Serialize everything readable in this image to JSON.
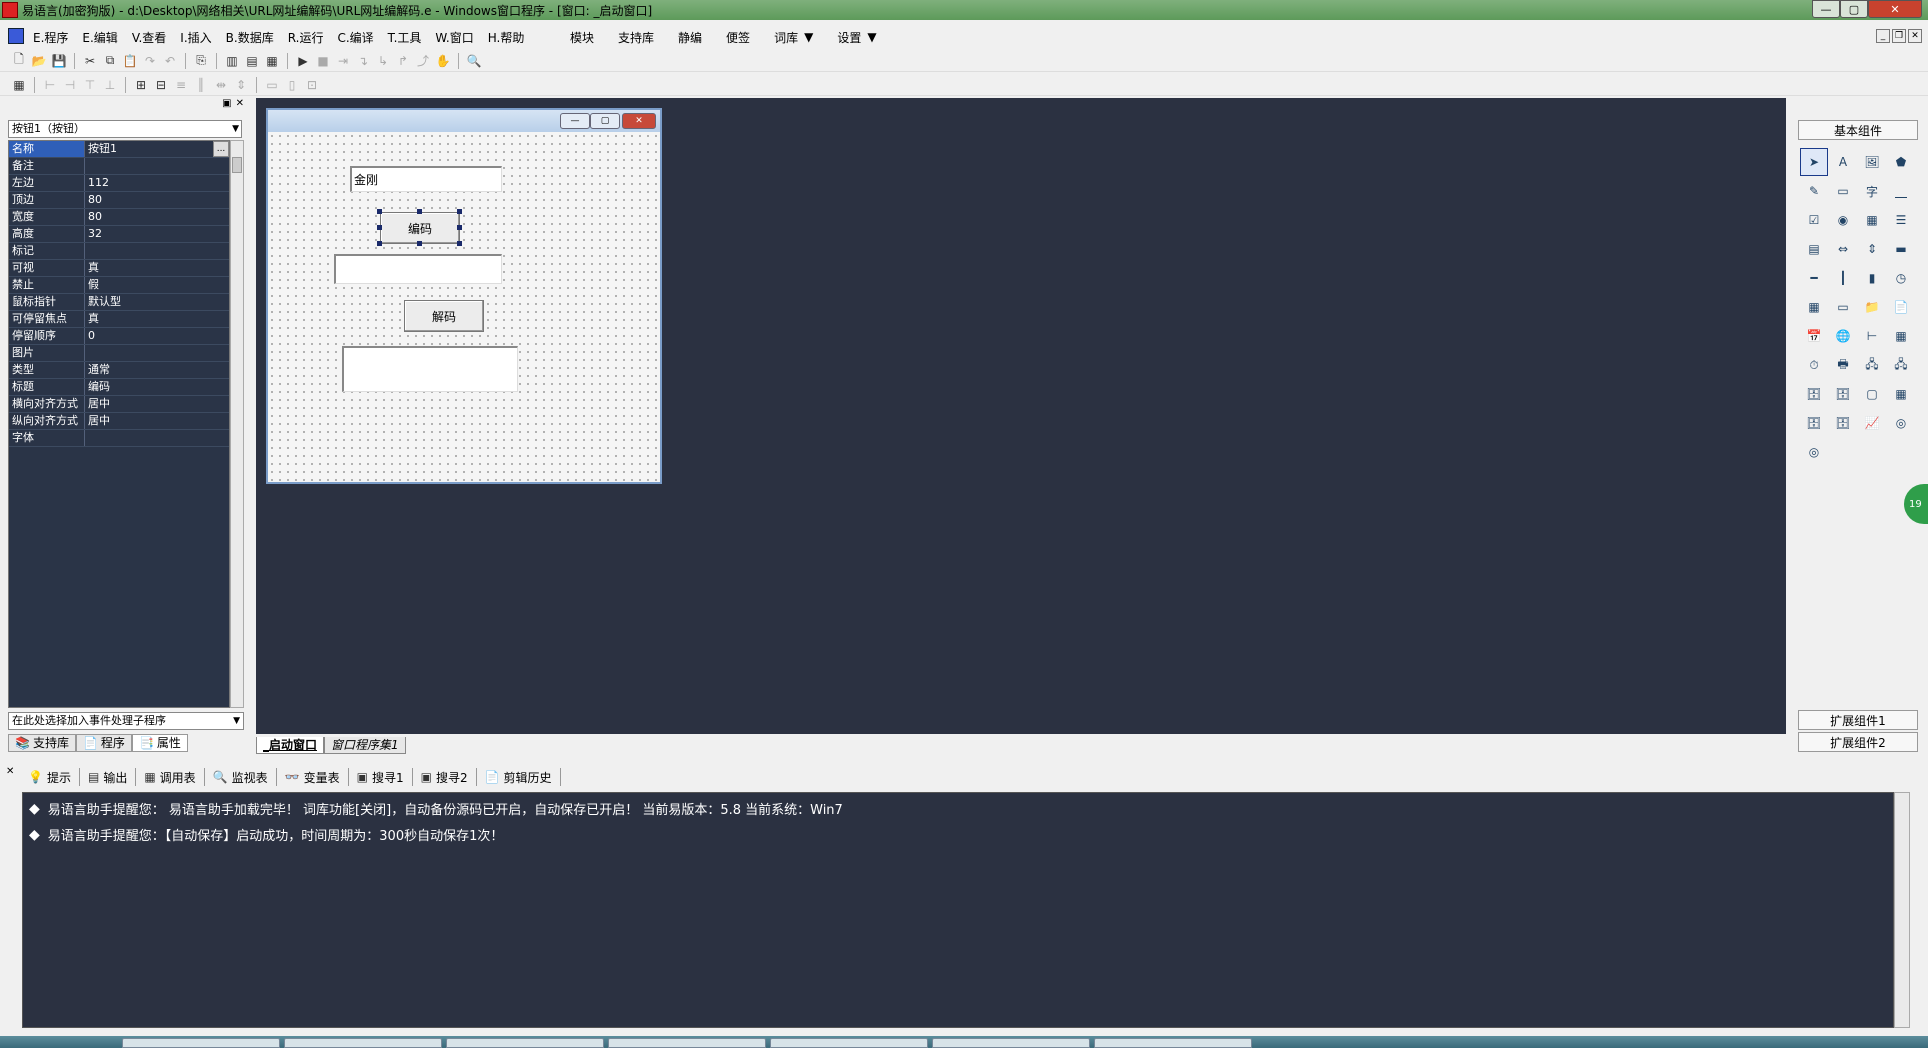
{
  "window": {
    "title": "易语言(加密狗版) - d:\\Desktop\\网络相关\\URL网址编解码\\URL网址编解码.e - Windows窗口程序 - [窗口: _启动窗口]"
  },
  "menu": {
    "items": [
      "E.程序",
      "E.编辑",
      "V.查看",
      "I.插入",
      "B.数据库",
      "R.运行",
      "C.编译",
      "T.工具",
      "W.窗口",
      "H.帮助"
    ],
    "right_items": [
      "模块",
      "支持库",
      "静编",
      "便签"
    ],
    "dropdown_items": [
      "词库",
      "设置"
    ]
  },
  "properties": {
    "selector": "按钮1（按钮）",
    "rows": [
      {
        "k": "名称",
        "v": "按钮1"
      },
      {
        "k": "备注",
        "v": ""
      },
      {
        "k": "左边",
        "v": "112"
      },
      {
        "k": "顶边",
        "v": "80"
      },
      {
        "k": "宽度",
        "v": "80"
      },
      {
        "k": "高度",
        "v": "32"
      },
      {
        "k": "标记",
        "v": ""
      },
      {
        "k": "可视",
        "v": "真"
      },
      {
        "k": "禁止",
        "v": "假"
      },
      {
        "k": "鼠标指针",
        "v": "默认型"
      },
      {
        "k": "可停留焦点",
        "v": "真"
      },
      {
        "k": "  停留顺序",
        "v": "0"
      },
      {
        "k": "图片",
        "v": ""
      },
      {
        "k": "类型",
        "v": "通常"
      },
      {
        "k": "标题",
        "v": "编码"
      },
      {
        "k": "横向对齐方式",
        "v": "居中"
      },
      {
        "k": "纵向对齐方式",
        "v": "居中"
      },
      {
        "k": "字体",
        "v": ""
      }
    ],
    "more_button": "...",
    "event_selector": "在此处选择加入事件处理子程序",
    "tabs": [
      "支持库",
      "程序",
      "属性"
    ]
  },
  "design_form": {
    "edit1_value": "金刚",
    "button_encode": "编码",
    "button_decode": "解码"
  },
  "doc_tabs": [
    "_启动窗口",
    "窗口程序集1"
  ],
  "components": {
    "title": "基本组件",
    "ext1": "扩展组件1",
    "ext2": "扩展组件2",
    "icons": [
      "cursor",
      "label",
      "picture",
      "shape",
      "pen-edit",
      "frame",
      "char",
      "line",
      "checkbox",
      "radio",
      "grid-box",
      "list-box",
      "list-view",
      "slider",
      "scroll",
      "ruler",
      "hline",
      "vline",
      "progress",
      "clock",
      "grid",
      "panel",
      "folder",
      "doc",
      "calendar",
      "globe",
      "tree",
      "table",
      "timer",
      "printer",
      "network",
      "net2",
      "db1",
      "db2",
      "window",
      "grid2",
      "db3",
      "db4",
      "chart",
      "odbc",
      "odbc2"
    ]
  },
  "output": {
    "tabs": [
      "提示",
      "输出",
      "调用表",
      "监视表",
      "变量表",
      "搜寻1",
      "搜寻2",
      "剪辑历史"
    ],
    "lines": [
      "易语言助手提醒您：  易语言助手加载完毕！  词库功能[关闭]，自动备份源码已开启，自动保存已开启！  当前易版本：5.8  当前系统：Win7",
      "易语言助手提醒您：【自动保存】启动成功，时间周期为：300秒自动保存1次！"
    ]
  },
  "bubble": "19"
}
